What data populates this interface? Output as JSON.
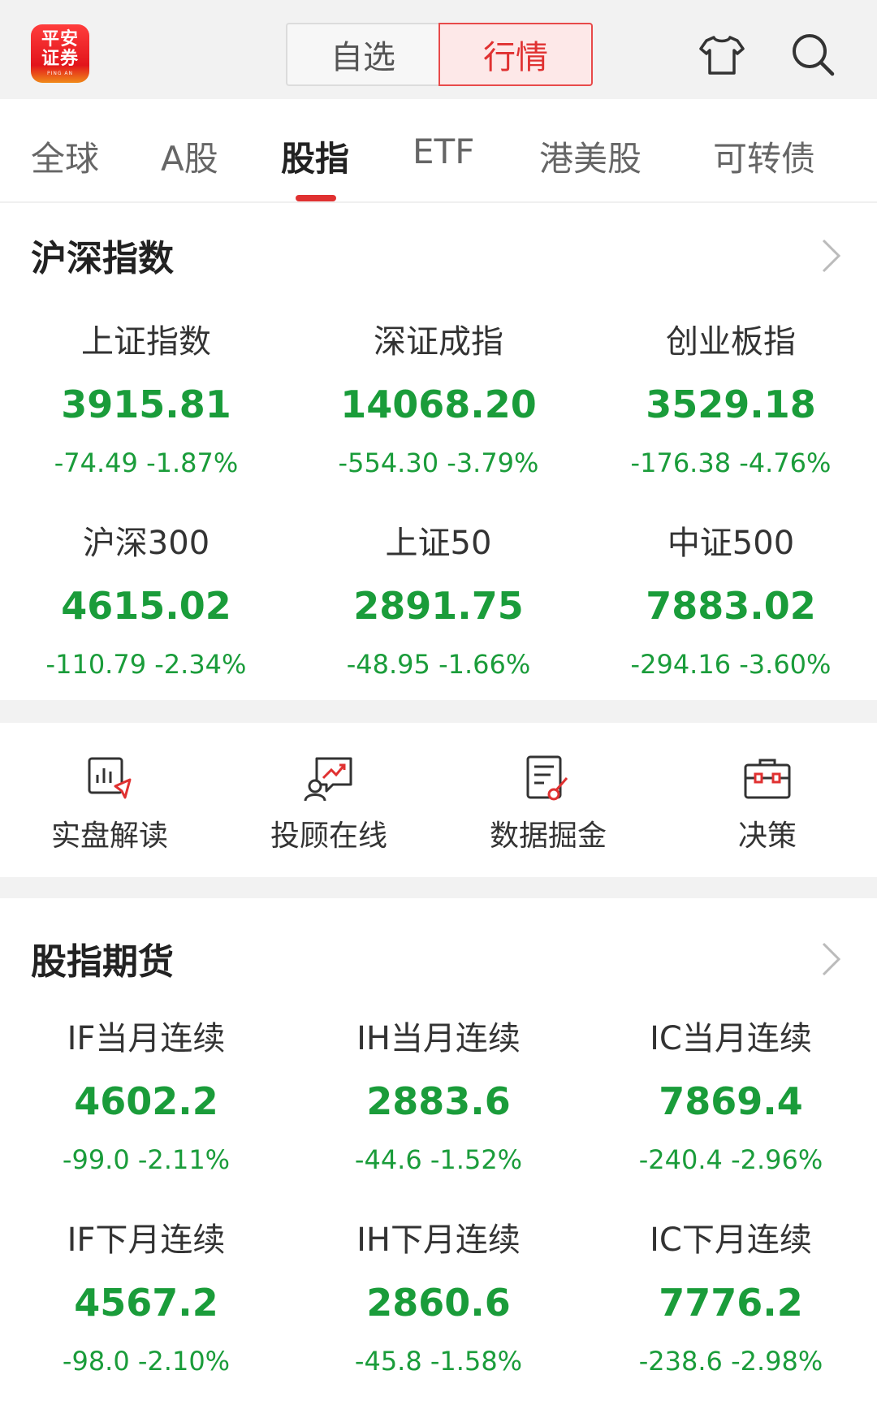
{
  "colors": {
    "accent": "#e03131",
    "down": "#1a9c3a"
  },
  "header": {
    "logo": {
      "line1": "平安",
      "line2": "证券",
      "line3": "PING AN"
    },
    "segment": [
      {
        "label": "自选",
        "active": false
      },
      {
        "label": "行情",
        "active": true
      }
    ],
    "icons": [
      "shirt-icon",
      "search-icon"
    ]
  },
  "tabs": [
    {
      "label": "全球"
    },
    {
      "label": "A股"
    },
    {
      "label": "股指",
      "active": true
    },
    {
      "label": "ETF"
    },
    {
      "label": "港美股"
    },
    {
      "label": "可转债"
    }
  ],
  "indices": {
    "title": "沪深指数",
    "items": [
      {
        "name": "上证指数",
        "price": "3915.81",
        "change": "-74.49 -1.87%"
      },
      {
        "name": "深证成指",
        "price": "14068.20",
        "change": "-554.30 -3.79%"
      },
      {
        "name": "创业板指",
        "price": "3529.18",
        "change": "-176.38 -4.76%"
      },
      {
        "name": "沪深300",
        "price": "4615.02",
        "change": "-110.79 -2.34%"
      },
      {
        "name": "上证50",
        "price": "2891.75",
        "change": "-48.95 -1.66%"
      },
      {
        "name": "中证500",
        "price": "7883.02",
        "change": "-294.16 -3.60%"
      }
    ]
  },
  "tools": [
    {
      "label": "实盘解读",
      "icon": "chart-report-icon"
    },
    {
      "label": "投顾在线",
      "icon": "advisor-icon"
    },
    {
      "label": "数据掘金",
      "icon": "data-dig-icon"
    },
    {
      "label": "决策",
      "icon": "toolbox-icon"
    }
  ],
  "futures": {
    "title": "股指期货",
    "items": [
      {
        "name": "IF当月连续",
        "price": "4602.2",
        "change": "-99.0 -2.11%"
      },
      {
        "name": "IH当月连续",
        "price": "2883.6",
        "change": "-44.6 -1.52%"
      },
      {
        "name": "IC当月连续",
        "price": "7869.4",
        "change": "-240.4 -2.96%"
      },
      {
        "name": "IF下月连续",
        "price": "4567.2",
        "change": "-98.0 -2.10%"
      },
      {
        "name": "IH下月连续",
        "price": "2860.6",
        "change": "-45.8 -1.58%"
      },
      {
        "name": "IC下月连续",
        "price": "7776.2",
        "change": "-238.6 -2.98%"
      }
    ]
  }
}
